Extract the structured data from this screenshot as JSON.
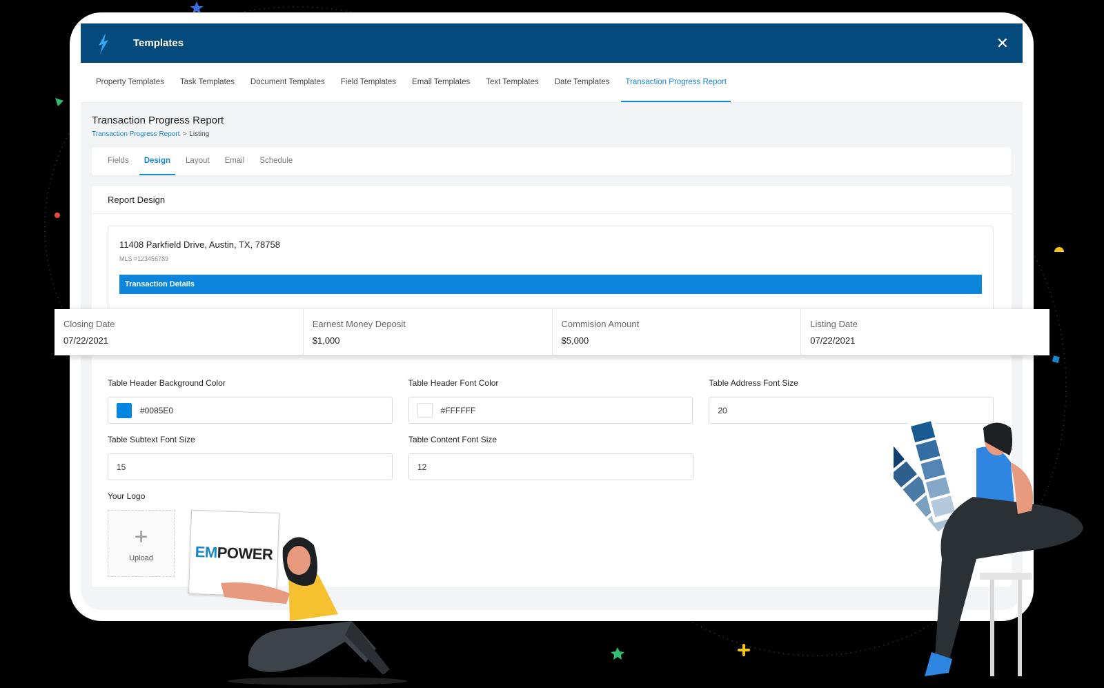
{
  "window": {
    "title": "Templates",
    "close": "✕"
  },
  "tabs": [
    {
      "label": "Property Templates"
    },
    {
      "label": "Task Templates"
    },
    {
      "label": "Document Templates"
    },
    {
      "label": "Field Templates"
    },
    {
      "label": "Email Templates"
    },
    {
      "label": "Text Templates"
    },
    {
      "label": "Date Templates"
    },
    {
      "label": "Transaction Progress Report",
      "active": true
    }
  ],
  "page": {
    "title": "Transaction Progress Report",
    "breadcrumb": {
      "link": "Transaction Progress Report",
      "separator": ">",
      "current": "Listing"
    }
  },
  "subtabs": [
    {
      "label": "Fields"
    },
    {
      "label": "Design",
      "active": true
    },
    {
      "label": "Layout"
    },
    {
      "label": "Email"
    },
    {
      "label": "Schedule"
    }
  ],
  "panel": {
    "title": "Report Design"
  },
  "preview": {
    "address": "11408 Parkfield Drive, Austin, TX, 78758",
    "mls": "MLS #123456789",
    "bar_title": "Transaction Details",
    "bar_color": "#0B86DC"
  },
  "details": [
    {
      "label": "Closing Date",
      "value": "07/22/2021"
    },
    {
      "label": "Earnest Money Deposit",
      "value": "$1,000"
    },
    {
      "label": "Commision Amount",
      "value": "$5,000"
    },
    {
      "label": "Listing Date",
      "value": "07/22/2021"
    }
  ],
  "form": {
    "header_bg": {
      "label": "Table Header Background Color",
      "value": "#0085E0",
      "swatch": "#0085E0"
    },
    "header_font": {
      "label": "Table Header Font Color",
      "value": "#FFFFFF",
      "swatch": "#FFFFFF"
    },
    "address_size": {
      "label": "Table Address Font Size",
      "value": "20"
    },
    "subtext_size": {
      "label": "Table Subtext Font Size",
      "value": "15"
    },
    "content_size": {
      "label": "Table Content Font Size",
      "value": "12"
    },
    "logo": {
      "label": "Your Logo",
      "upload_label": "Upload",
      "plus": "+"
    }
  },
  "logo_card": {
    "part1": "EM",
    "part2": "POWER"
  },
  "icons": {
    "app_logo": "lightning-bolt-icon",
    "close": "close-icon",
    "upload": "plus-icon"
  },
  "colors": {
    "titlebar": "#054A7C",
    "accent": "#1A86CC"
  }
}
